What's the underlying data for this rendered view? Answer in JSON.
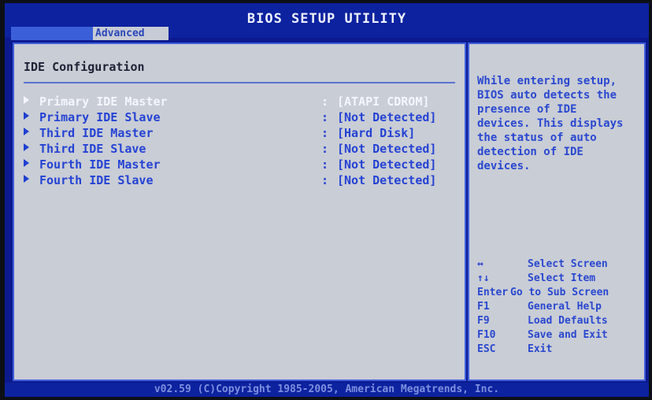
{
  "header": {
    "title": "BIOS SETUP UTILITY",
    "active_tab": "Advanced"
  },
  "main": {
    "section_title": "IDE Configuration",
    "items": [
      {
        "label": "Primary IDE Master",
        "separator": ":",
        "value": "[ATAPI CDROM]",
        "selected": true
      },
      {
        "label": "Primary IDE Slave",
        "separator": ":",
        "value": "[Not Detected]"
      },
      {
        "label": "Third IDE Master",
        "separator": ":",
        "value": "[Hard Disk]"
      },
      {
        "label": "Third IDE Slave",
        "separator": ":",
        "value": "[Not Detected]"
      },
      {
        "label": "Fourth IDE Master",
        "separator": ":",
        "value": "[Not Detected]"
      },
      {
        "label": "Fourth IDE Slave",
        "separator": ":",
        "value": "[Not Detected]"
      }
    ]
  },
  "help": {
    "lines": [
      "While entering setup,",
      "BIOS auto detects the",
      "presence of IDE",
      "devices. This displays",
      "the status of auto",
      "detection of IDE",
      "devices."
    ],
    "keys": [
      {
        "key": "↔",
        "desc": "Select Screen"
      },
      {
        "key": "↑↓",
        "desc": "Select Item"
      },
      {
        "key": "Enter",
        "desc": "Go to Sub Screen"
      },
      {
        "key": "F1",
        "desc": "General Help"
      },
      {
        "key": "F9",
        "desc": "Load Defaults"
      },
      {
        "key": "F10",
        "desc": "Save and Exit"
      },
      {
        "key": "ESC",
        "desc": "Exit"
      }
    ]
  },
  "footer": {
    "text": "v02.59 (C)Copyright 1985-2005, American Megatrends, Inc."
  },
  "colors": {
    "background": "#0b1a8e",
    "panel": "#c9cdd5",
    "text": "#2543d4",
    "selected_text": "#f4f6ff"
  }
}
